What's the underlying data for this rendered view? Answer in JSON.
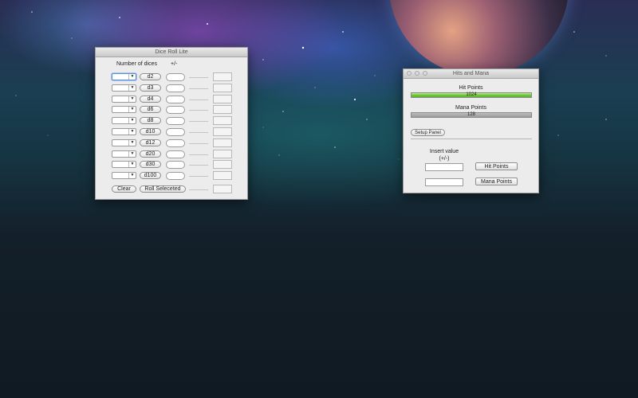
{
  "dice_window": {
    "title": "Dice Roll Lite",
    "header_number": "Number of dices",
    "header_plusminus": "+/-",
    "dice": [
      "d2",
      "d3",
      "d4",
      "d6",
      "d8",
      "d10",
      "d12",
      "d20",
      "d30",
      "d100"
    ],
    "clear_label": "Clear",
    "roll_selected_label": "Roll Seleceted"
  },
  "hits_mana_window": {
    "title": "Hits and Mana",
    "hit_points_label": "Hit Points",
    "hit_points_value": "1024",
    "hit_points_fill": 1.0,
    "mana_points_label": "Mana Points",
    "mana_points_value": "128",
    "mana_points_fill": 1.0,
    "setup_panel_label": "Setup Panel",
    "insert_value_label": "Insert value",
    "insert_value_hint": "(+/-)",
    "hit_points_button": "Hit Points",
    "mana_points_button": "Mana Points"
  },
  "colors": {
    "hit_bar": "#6bc536",
    "mana_bar": "#9a9a9a",
    "focus_ring": "#5c8fd6"
  }
}
